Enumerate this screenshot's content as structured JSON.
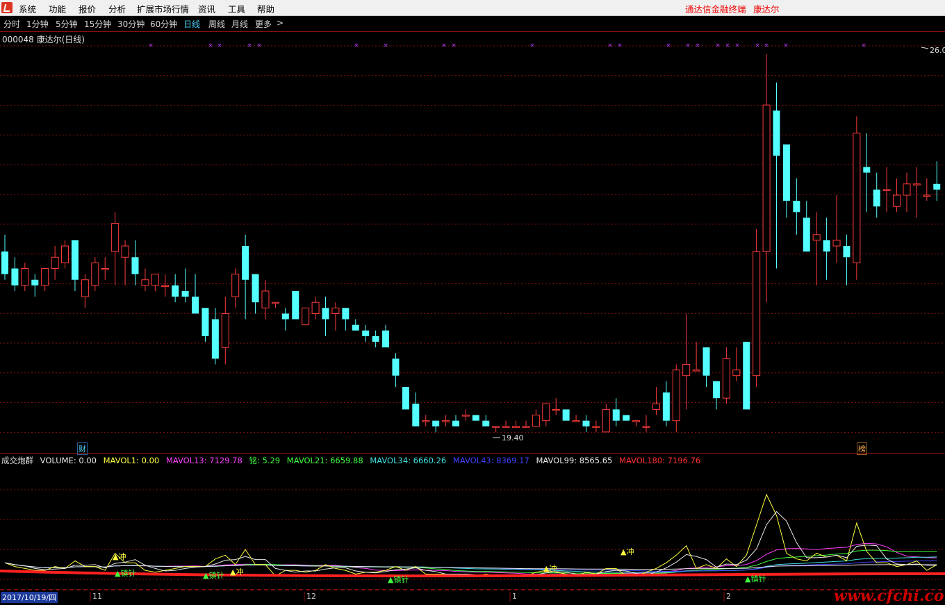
{
  "menubar": {
    "items": [
      "系统",
      "功能",
      "报价",
      "分析",
      "扩展市场行情",
      "资讯",
      "工具",
      "帮助"
    ],
    "terminal_name": "通达信金融终端",
    "stock_name": "康达尔"
  },
  "tabs": [
    "分时",
    "1分钟",
    "5分钟",
    "15分钟",
    "30分钟",
    "60分钟",
    "日线",
    "周线",
    "月线",
    "更多"
  ],
  "tabs_more_arrow": ">",
  "chart_title": "000048 康达尔(日线)",
  "price_high_label": "26.0",
  "price_low_label": "19.40",
  "badges": {
    "cai": "财",
    "bang": "榜"
  },
  "indicator": {
    "name": "成交炮群",
    "items": [
      {
        "label": "VOLUME: 0.00",
        "color": "#e8e8e8"
      },
      {
        "label": "MAVOL1: 0.00",
        "color": "#ffff40"
      },
      {
        "label": "MAVOL13: 7129.78",
        "color": "#ff40ff"
      },
      {
        "label": "铭: 5.29",
        "color": "#40ff40"
      },
      {
        "label": "MAVOL21: 6659.88",
        "color": "#40ff40"
      },
      {
        "label": "MAVOL34: 6660.26",
        "color": "#40e0e0"
      },
      {
        "label": "MAVOL43: 8369.17",
        "color": "#4040ff"
      },
      {
        "label": "MAVOL99: 8565.65",
        "color": "#e8e8e8"
      },
      {
        "label": "MAVOL180: 7196.76",
        "color": "#ff3030"
      }
    ]
  },
  "signals": {
    "chong": "▲冲",
    "zhen": "▲镇针"
  },
  "date_axis": {
    "start": "2017/10/19/四",
    "months": [
      "11",
      "12",
      "1",
      "2"
    ]
  },
  "watermark": "www.cfchi.com",
  "colors": {
    "up": "#ff3c3c",
    "down": "#54ffff",
    "grid": "#8a1010",
    "marker": "#c040ff"
  },
  "chart_data": {
    "type": "candlestick",
    "candles": [
      [
        22.6,
        22.9,
        22.1,
        22.2
      ],
      [
        22.3,
        22.5,
        21.9,
        22.0
      ],
      [
        22.0,
        22.4,
        21.9,
        22.3
      ],
      [
        22.1,
        22.2,
        21.8,
        22.0
      ],
      [
        22.0,
        22.3,
        21.9,
        22.3
      ],
      [
        22.3,
        22.7,
        22.1,
        22.5
      ],
      [
        22.4,
        22.8,
        22.3,
        22.7
      ],
      [
        22.8,
        22.8,
        21.9,
        22.1
      ],
      [
        21.8,
        22.2,
        21.6,
        22.1
      ],
      [
        22.0,
        22.5,
        21.9,
        22.4
      ],
      [
        22.3,
        22.5,
        22.1,
        22.3
      ],
      [
        22.6,
        23.3,
        22.0,
        23.1
      ],
      [
        22.5,
        22.8,
        22.0,
        22.7
      ],
      [
        22.5,
        22.8,
        22.0,
        22.2
      ],
      [
        22.0,
        22.3,
        21.9,
        22.1
      ],
      [
        22.0,
        22.2,
        21.9,
        22.2
      ],
      [
        22.0,
        22.2,
        21.8,
        22.0
      ],
      [
        22.0,
        22.2,
        21.7,
        21.8
      ],
      [
        21.9,
        22.3,
        21.7,
        21.8
      ],
      [
        21.8,
        22.2,
        21.6,
        21.5
      ],
      [
        21.6,
        21.6,
        21.0,
        21.1
      ],
      [
        21.4,
        21.6,
        20.6,
        20.7
      ],
      [
        20.9,
        21.8,
        20.6,
        21.5
      ],
      [
        21.8,
        22.3,
        21.6,
        22.2
      ],
      [
        22.7,
        22.9,
        21.4,
        22.1
      ],
      [
        22.2,
        22.2,
        21.5,
        21.7
      ],
      [
        21.6,
        22.1,
        21.4,
        21.9
      ],
      [
        21.7,
        21.7,
        21.6,
        21.7
      ],
      [
        21.5,
        21.6,
        21.2,
        21.4
      ],
      [
        21.9,
        21.9,
        21.5,
        21.4
      ],
      [
        21.3,
        21.6,
        21.3,
        21.6
      ],
      [
        21.5,
        21.8,
        21.4,
        21.7
      ],
      [
        21.6,
        21.8,
        21.1,
        21.4
      ],
      [
        21.5,
        21.7,
        21.2,
        21.6
      ],
      [
        21.6,
        21.6,
        21.2,
        21.4
      ],
      [
        21.3,
        21.4,
        21.2,
        21.2
      ],
      [
        21.2,
        21.3,
        21.0,
        21.1
      ],
      [
        21.1,
        21.2,
        20.9,
        21.0
      ],
      [
        21.2,
        21.3,
        20.9,
        20.9
      ],
      [
        20.7,
        20.8,
        20.2,
        20.4
      ],
      [
        20.2,
        20.2,
        19.8,
        19.8
      ],
      [
        19.9,
        20.1,
        19.5,
        19.5
      ],
      [
        19.6,
        19.7,
        19.5,
        19.6
      ],
      [
        19.6,
        19.6,
        19.4,
        19.5
      ],
      [
        19.6,
        19.7,
        19.5,
        19.6
      ],
      [
        19.6,
        19.7,
        19.5,
        19.5
      ],
      [
        19.7,
        19.8,
        19.6,
        19.7
      ],
      [
        19.7,
        19.7,
        19.6,
        19.6
      ],
      [
        19.6,
        19.7,
        19.5,
        19.5
      ],
      [
        19.5,
        19.5,
        19.4,
        19.5
      ],
      [
        19.5,
        19.6,
        19.5,
        19.5
      ],
      [
        19.5,
        19.6,
        19.5,
        19.5
      ],
      [
        19.5,
        19.6,
        19.5,
        19.5
      ],
      [
        19.5,
        19.8,
        19.5,
        19.7
      ],
      [
        19.6,
        19.9,
        19.5,
        19.9
      ],
      [
        19.8,
        20.0,
        19.7,
        19.8
      ],
      [
        19.8,
        19.8,
        19.6,
        19.6
      ],
      [
        19.6,
        19.7,
        19.6,
        19.6
      ],
      [
        19.6,
        19.7,
        19.4,
        19.5
      ],
      [
        19.5,
        19.6,
        19.4,
        19.5
      ],
      [
        19.4,
        19.9,
        19.4,
        19.8
      ],
      [
        19.8,
        20.0,
        19.5,
        19.6
      ],
      [
        19.7,
        19.7,
        19.6,
        19.6
      ],
      [
        19.6,
        19.6,
        19.5,
        19.6
      ],
      [
        19.5,
        19.7,
        19.4,
        19.5
      ],
      [
        19.8,
        20.2,
        19.7,
        19.9
      ],
      [
        20.1,
        20.3,
        19.5,
        19.6
      ],
      [
        19.6,
        20.6,
        19.4,
        20.5
      ],
      [
        20.4,
        21.5,
        19.8,
        20.6
      ],
      [
        20.5,
        21.0,
        20.5,
        20.5
      ],
      [
        20.9,
        20.9,
        20.2,
        20.4
      ],
      [
        20.3,
        20.3,
        19.8,
        20.0
      ],
      [
        20.0,
        20.9,
        19.9,
        20.7
      ],
      [
        20.4,
        20.9,
        20.3,
        20.5
      ],
      [
        21.0,
        21.0,
        19.8,
        19.8
      ],
      [
        20.4,
        23.0,
        20.2,
        22.6
      ],
      [
        22.6,
        26.1,
        21.7,
        25.2
      ],
      [
        25.1,
        25.6,
        22.3,
        24.3
      ],
      [
        24.5,
        24.5,
        23.2,
        23.5
      ],
      [
        23.5,
        23.9,
        22.9,
        23.3
      ],
      [
        23.2,
        23.5,
        22.6,
        22.6
      ],
      [
        22.8,
        23.3,
        22.0,
        22.9
      ],
      [
        22.8,
        23.2,
        22.1,
        22.6
      ],
      [
        22.7,
        23.6,
        22.4,
        22.8
      ],
      [
        22.7,
        22.9,
        22.0,
        22.5
      ],
      [
        22.4,
        25.0,
        22.1,
        24.7
      ],
      [
        24.1,
        24.7,
        23.3,
        24.0
      ],
      [
        23.7,
        24.0,
        23.2,
        23.4
      ],
      [
        23.7,
        24.1,
        23.3,
        23.7
      ],
      [
        23.4,
        23.9,
        23.3,
        23.6
      ],
      [
        23.6,
        24.0,
        23.3,
        23.8
      ],
      [
        23.8,
        24.1,
        23.2,
        23.8
      ],
      [
        23.6,
        23.9,
        23.5,
        23.6
      ],
      [
        23.8,
        24.2,
        23.5,
        23.7
      ]
    ],
    "price_high": 26.0,
    "price_low": 19.4
  }
}
